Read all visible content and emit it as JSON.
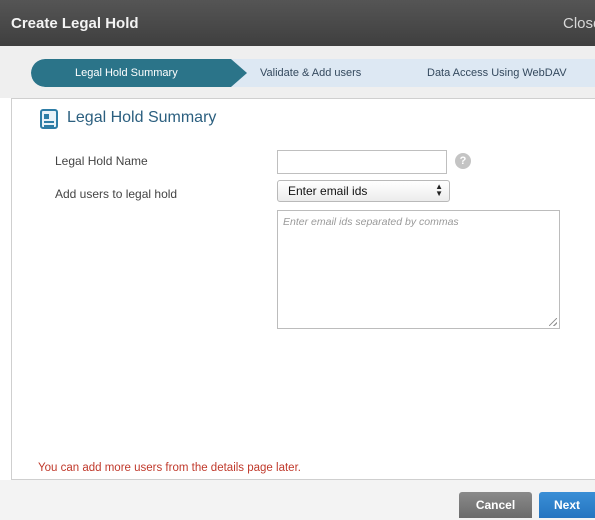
{
  "dialog": {
    "title": "Create Legal Hold",
    "close_label": "Close"
  },
  "wizard": {
    "steps": [
      {
        "label": "Legal Hold Summary",
        "active": true
      },
      {
        "label": "Validate & Add users",
        "active": false
      },
      {
        "label": "Data Access Using WebDAV",
        "active": false
      }
    ]
  },
  "section": {
    "icon": "document-icon",
    "title": "Legal Hold Summary"
  },
  "form": {
    "name_label": "Legal Hold Name",
    "name_value": "",
    "help_icon": "?",
    "users_label": "Add users to legal hold",
    "users_select_value": "Enter email ids",
    "emails_placeholder": "Enter email ids separated by commas"
  },
  "note": "You can add more users from the details page later.",
  "footer": {
    "cancel_label": "Cancel",
    "next_label": "Next"
  },
  "colors": {
    "titlebar": "#4a4a4a",
    "active_step": "#2b7489",
    "inactive_step": "#dde8f3",
    "note_text": "#c0392b",
    "next_button": "#2e80cb",
    "cancel_button": "#7a7a7a"
  }
}
